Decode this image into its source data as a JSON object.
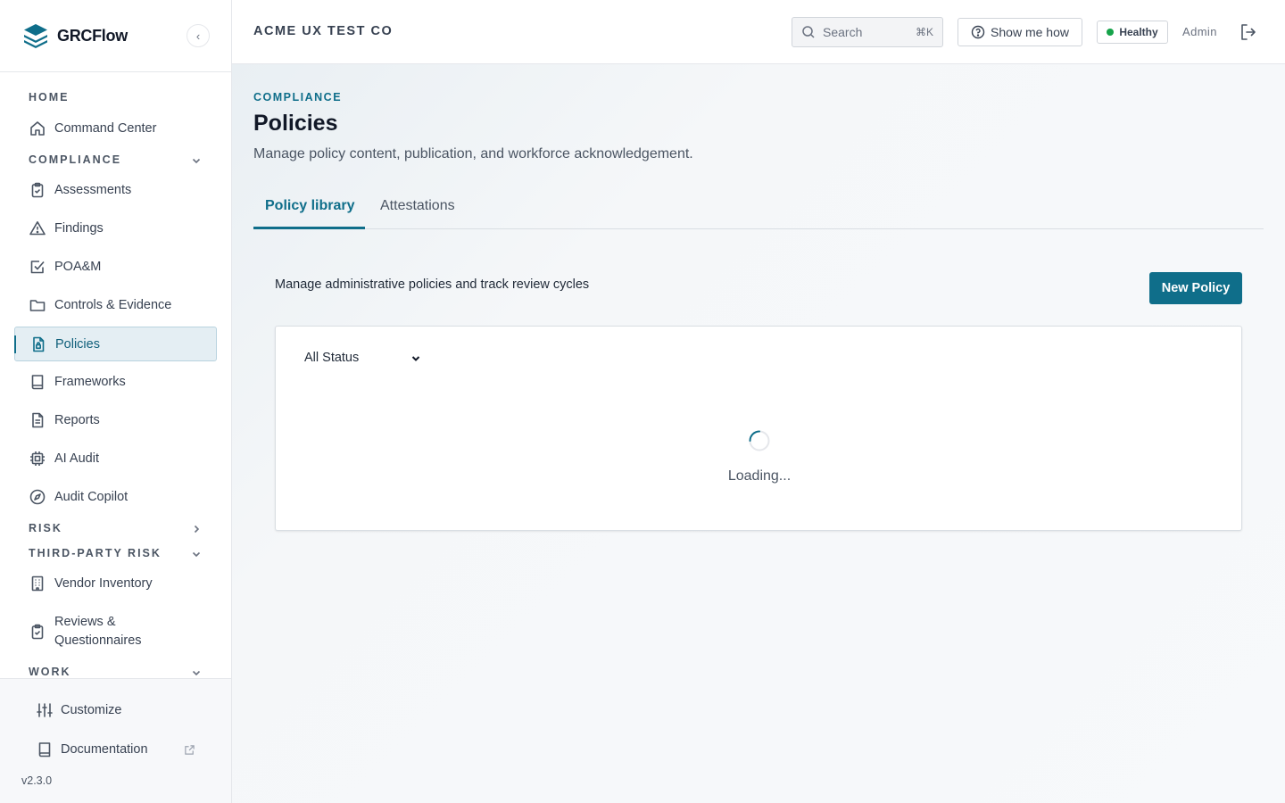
{
  "brand": {
    "name": "GRCFlow",
    "collapse_icon": "‹"
  },
  "header": {
    "org": "ACME UX TEST CO",
    "search_placeholder": "Search",
    "search_shortcut": "⌘K",
    "help_label": "Show me how",
    "health_label": "Healthy",
    "user": "Admin"
  },
  "sidebar": {
    "sections": {
      "home": "HOME",
      "compliance": "COMPLIANCE",
      "risk": "RISK",
      "tpr": "THIRD-PARTY RISK",
      "work": "WORK"
    },
    "items": {
      "command_center": "Command Center",
      "assessments": "Assessments",
      "findings": "Findings",
      "poam": "POA&M",
      "controls": "Controls & Evidence",
      "policies": "Policies",
      "frameworks": "Frameworks",
      "reports": "Reports",
      "ai_audit": "AI Audit",
      "audit_copilot": "Audit Copilot",
      "vendor_inventory": "Vendor Inventory",
      "reviews_line1": "Reviews &",
      "reviews_line2": "Questionnaires"
    },
    "footer": {
      "customize": "Customize",
      "documentation": "Documentation",
      "version": "v2.3.0"
    }
  },
  "page": {
    "eyebrow": "COMPLIANCE",
    "title": "Policies",
    "description": "Manage policy content, publication, and workforce acknowledgement.",
    "tabs": [
      "Policy library",
      "Attestations"
    ],
    "section_description": "Manage administrative policies and track review cycles",
    "new_button": "New Policy",
    "status_filter": "All Status",
    "loading": "Loading..."
  },
  "colors": {
    "accent": "#0f6e8a",
    "healthy": "#16a34a"
  }
}
